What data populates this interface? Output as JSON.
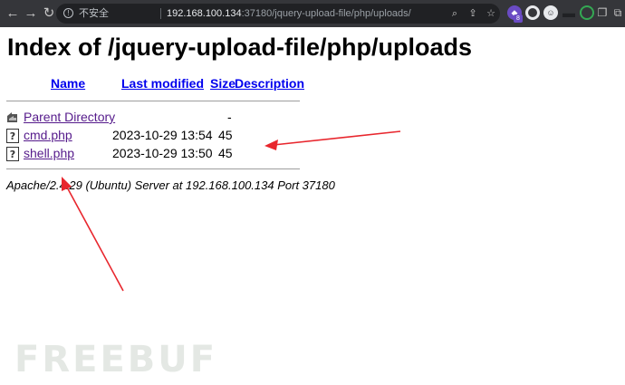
{
  "browser": {
    "insecure_label": "不安全",
    "url_host": "192.168.100.134",
    "url_path": ":37180/jquery-upload-file/php/uploads/",
    "extension_badge": "8"
  },
  "page": {
    "title": "Index of /jquery-upload-file/php/uploads",
    "columns": {
      "name": "Name",
      "last_modified": "Last modified",
      "size": "Size",
      "description": "Description"
    },
    "rows": [
      {
        "name": "Parent Directory",
        "date": "",
        "size": "-",
        "icon": "back-folder-icon"
      },
      {
        "name": "cmd.php",
        "date": "2023-10-29 13:54",
        "size": "45",
        "icon": "unknown-file-icon"
      },
      {
        "name": "shell.php",
        "date": "2023-10-29 13:50",
        "size": "45",
        "icon": "unknown-file-icon"
      }
    ],
    "address": "Apache/2.4.29 (Ubuntu) Server at 192.168.100.134 Port 37180"
  },
  "watermark": "FREEBUF",
  "colors": {
    "annotation_arrow": "#e8262d",
    "link": "#0000ee",
    "visited_link": "#551a8b"
  }
}
